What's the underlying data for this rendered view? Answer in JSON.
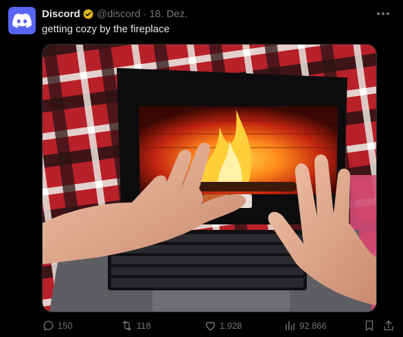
{
  "tweet": {
    "author_name": "Discord",
    "handle": "@discord",
    "separator": "·",
    "date": "18. Dez.",
    "text": "getting cozy by the fireplace",
    "avatar_icon": "discord-logo-icon",
    "verified_icon": "verified-gold-badge-icon",
    "more_icon": "more-icon"
  },
  "media": {
    "image_icon": "photo-hands-on-laptop-fireplace"
  },
  "actions": {
    "reply": {
      "icon": "reply-icon",
      "count": "150"
    },
    "retweet": {
      "icon": "retweet-icon",
      "count": "118"
    },
    "like": {
      "icon": "heart-icon",
      "count": "1.928"
    },
    "views": {
      "icon": "views-icon",
      "count": "92.866"
    },
    "bookmark": {
      "icon": "bookmark-icon"
    },
    "share": {
      "icon": "share-icon"
    }
  },
  "colors": {
    "background": "#000000",
    "text": "#e7e9ea",
    "muted": "#71767b",
    "discord_blurple": "#5865f2",
    "verified_gold": "#e2b719"
  }
}
